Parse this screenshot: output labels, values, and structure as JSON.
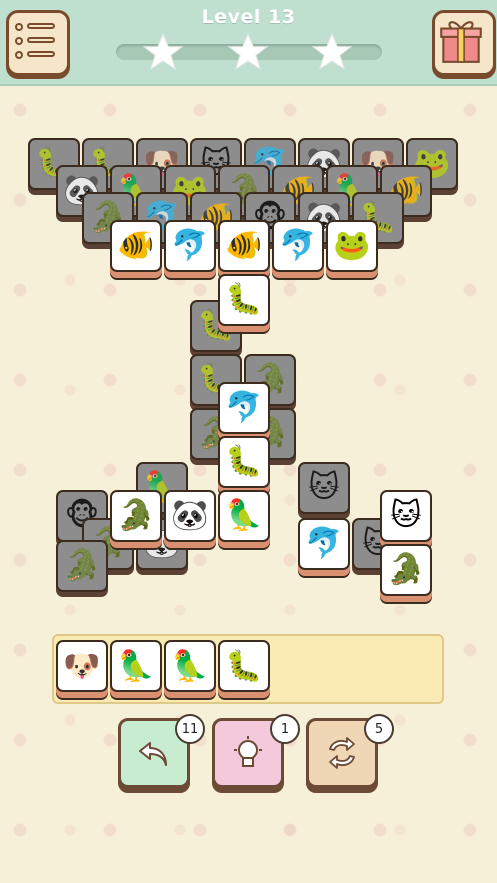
{
  "header": {
    "level_title": "Level 13",
    "stars": 3,
    "menu_icon": "list-menu-icon",
    "gift_icon": "gift-box-icon"
  },
  "colors": {
    "header_bg": "#bfe0cf",
    "tile_face": "#ffffff",
    "tile_covered": "#8d8d8d",
    "tile_edge": "#d99071",
    "tray_bg": "#faeab3",
    "undo_bg": "#c7eccf",
    "hint_bg": "#f4c9dc",
    "shuffle_bg": "#efd6b4"
  },
  "glyphs": {
    "frog": "🐸",
    "panda": "🐼",
    "cat": "🐱",
    "dog": "🐶",
    "dolphin": "🐬",
    "fish": "🐠",
    "parrot": "🦜",
    "caterpillar": "🐛",
    "crocodile": "🐊",
    "monkey": "🐵"
  },
  "board": {
    "covered_tiles": [
      "caterpillar",
      "caterpillar",
      "dog",
      "cat",
      "dolphin",
      "panda",
      "dog",
      "frog",
      "panda",
      "parrot",
      "frog",
      "crocodile",
      "fish",
      "parrot",
      "fish",
      "crocodile",
      "dolphin",
      "fish",
      "monkey",
      "panda",
      "caterpillar",
      "caterpillar",
      "crocodile",
      "caterpillar",
      "crocodile",
      "crocodile",
      "parrot",
      "cat",
      "monkey",
      "crocodile",
      "panda",
      "cat",
      "crocodile"
    ],
    "free_tiles": [
      "fish",
      "dolphin",
      "fish",
      "dolphin",
      "frog",
      "caterpillar",
      "dolphin",
      "caterpillar",
      "crocodile",
      "panda",
      "parrot",
      "dolphin",
      "cat",
      "crocodile"
    ]
  },
  "tray": {
    "slots": 7,
    "tiles": [
      "dog",
      "parrot",
      "parrot",
      "caterpillar"
    ]
  },
  "tools": {
    "undo": {
      "icon": "undo-arrow-icon",
      "count": "11"
    },
    "hint": {
      "icon": "lightbulb-icon",
      "count": "1"
    },
    "shuffle": {
      "icon": "shuffle-icon",
      "count": "5"
    }
  }
}
